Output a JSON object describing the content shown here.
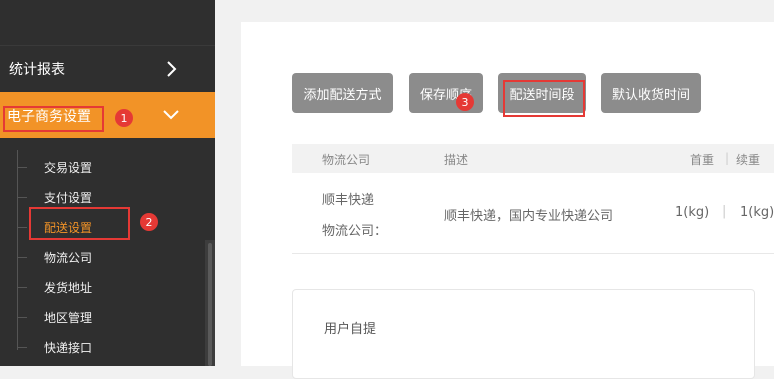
{
  "sidebar": {
    "stats_label": "统计报表",
    "ecom_label": "电子商务设置",
    "sub_items": [
      "交易设置",
      "支付设置",
      "配送设置",
      "物流公司",
      "发货地址",
      "地区管理",
      "快递接口"
    ]
  },
  "annotations": [
    "1",
    "2",
    "3"
  ],
  "toolbar": {
    "add_label": "添加配送方式",
    "save_order_label": "保存顺序",
    "time_slot_label": "配送时间段",
    "default_time_label": "默认收货时间"
  },
  "table": {
    "headers": [
      "物流公司",
      "描述",
      "首重",
      "|",
      "续重"
    ],
    "row": {
      "company_line1": "顺丰快递",
      "company_line2": "物流公司：",
      "description": "顺丰快递，国内专业快递公司",
      "first_weight": "1(kg)",
      "sep": "|",
      "extra_weight": "1(kg)"
    }
  },
  "pickup": {
    "label": "用户自提"
  },
  "colors": {
    "accent": "#f29327",
    "annotation_red": "#e53935",
    "button_gray": "#8c8c8c",
    "sidebar_bg": "#2f2f2f"
  }
}
